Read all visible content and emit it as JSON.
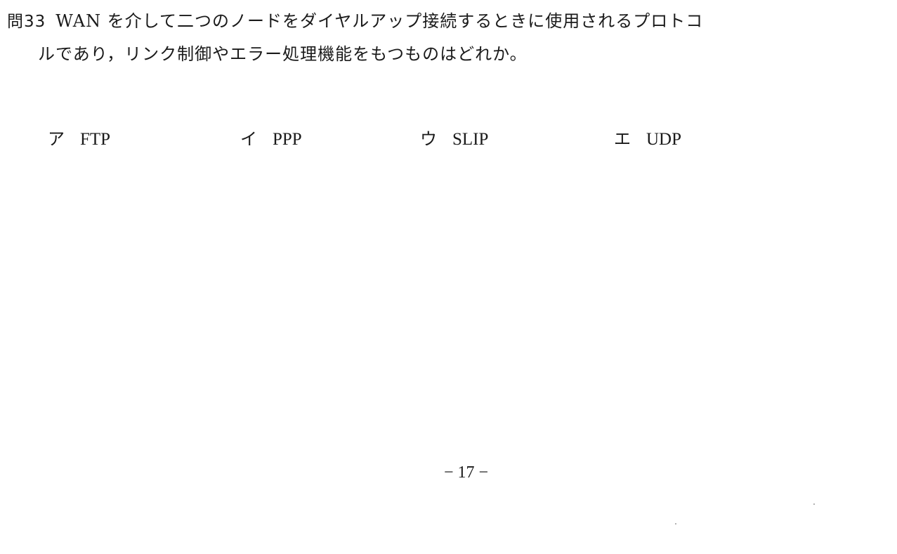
{
  "question": {
    "number": "問33",
    "line1": "WAN を介して二つのノードをダイヤルアップ接続するときに使用されるプロトコ",
    "line2": "ルであり，リンク制御やエラー処理機能をもつものはどれか。"
  },
  "options": [
    {
      "mark": "ア",
      "text": "FTP"
    },
    {
      "mark": "イ",
      "text": "PPP"
    },
    {
      "mark": "ウ",
      "text": "SLIP"
    },
    {
      "mark": "エ",
      "text": "UDP"
    }
  ],
  "footer": {
    "page_number": "− 17 −"
  }
}
